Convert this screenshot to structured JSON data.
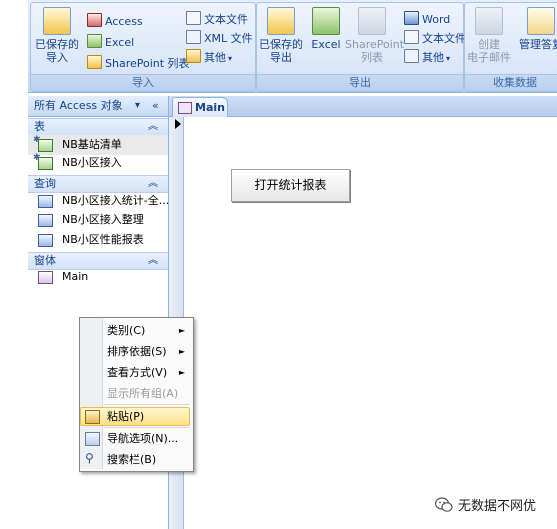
{
  "ribbon": {
    "import_group": {
      "label": "导入",
      "saved_import": "已保存的\n导入",
      "access": "Access",
      "excel": "Excel",
      "sharepoint": "SharePoint 列表",
      "text_file": "文本文件",
      "xml_file": "XML 文件",
      "other": "其他"
    },
    "export_group": {
      "label": "导出",
      "saved_export": "已保存的\n导出",
      "excel": "Excel",
      "sharepoint": "SharePoint\n列表",
      "word": "Word",
      "text_file": "文本文件",
      "other": "其他"
    },
    "collect_group": {
      "label": "收集数据",
      "create_email": "创建\n电子邮件",
      "manage_replies": "管理答复"
    }
  },
  "nav": {
    "title": "所有 Access 对象",
    "sections": {
      "tables": {
        "label": "表",
        "items": [
          "NB基站清单",
          "NB小区接入"
        ]
      },
      "queries": {
        "label": "查询",
        "items": [
          "NB小区接入统计-全...",
          "NB小区接入整理",
          "NB小区性能报表"
        ]
      },
      "forms": {
        "label": "窗体",
        "items": [
          "Main"
        ]
      }
    }
  },
  "document": {
    "tab_label": "Main",
    "button_label": "打开统计报表"
  },
  "context_menu": {
    "items": [
      {
        "label": "类别(C)",
        "submenu": true,
        "enabled": true
      },
      {
        "label": "排序依据(S)",
        "submenu": true,
        "enabled": true
      },
      {
        "label": "查看方式(V)",
        "submenu": true,
        "enabled": true
      },
      {
        "label": "显示所有组(A)",
        "submenu": false,
        "enabled": false
      },
      {
        "label": "粘贴(P)",
        "submenu": false,
        "enabled": true,
        "highlighted": true
      },
      {
        "label": "导航选项(N)...",
        "submenu": false,
        "enabled": true
      },
      {
        "label": "搜索栏(B)",
        "submenu": false,
        "enabled": true
      }
    ]
  },
  "watermark": "无数据不网优",
  "icons": {
    "submenu_arrow": "►",
    "chevron_up": "︽",
    "dropdown": "▾"
  }
}
